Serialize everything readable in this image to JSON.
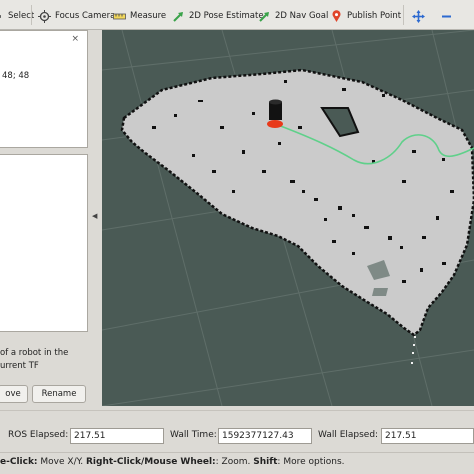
{
  "toolbar": {
    "select": "Select",
    "focus_camera": "Focus Camera",
    "measure": "Measure",
    "pose_estimate": "2D Pose Estimate",
    "nav_goal": "2D Nav Goal",
    "publish_point": "Publish Point",
    "icons": [
      "select-cursor-icon",
      "focus-camera-icon",
      "measure-icon",
      "pose-estimate-arrow-icon",
      "nav-goal-arrow-icon",
      "publish-point-pin-icon",
      "move-camera-icon",
      "minus-icon"
    ]
  },
  "left_panel": {
    "close": "×",
    "property_value": "48; 48",
    "description_line1": "of a robot in the",
    "description_line2": "urrent TF",
    "remove_button": "ove",
    "rename_button": "Rename",
    "collapse_arrow": "◀"
  },
  "timebar": {
    "ros_elapsed_label": "ROS Elapsed:",
    "ros_elapsed_value": "217.51",
    "wall_time_label": "Wall Time:",
    "wall_time_value": "1592377127.43",
    "wall_elapsed_label": "Wall Elapsed:",
    "wall_elapsed_value": "217.51"
  },
  "statusbar": {
    "left_click": "e-Click:",
    "left_action": " Move X/Y. ",
    "right_click": "Right-Click/Mouse Wheel:",
    "right_action": ": Zoom. ",
    "shift": "Shift",
    "shift_action": ": More options."
  },
  "colors": {
    "background": "#4a5a55",
    "grid": "#5f6e69",
    "map_free": "#cbcbcb",
    "obstacle": "#111111",
    "path": "#5fd08a",
    "robot_marker": "#e8391a"
  }
}
